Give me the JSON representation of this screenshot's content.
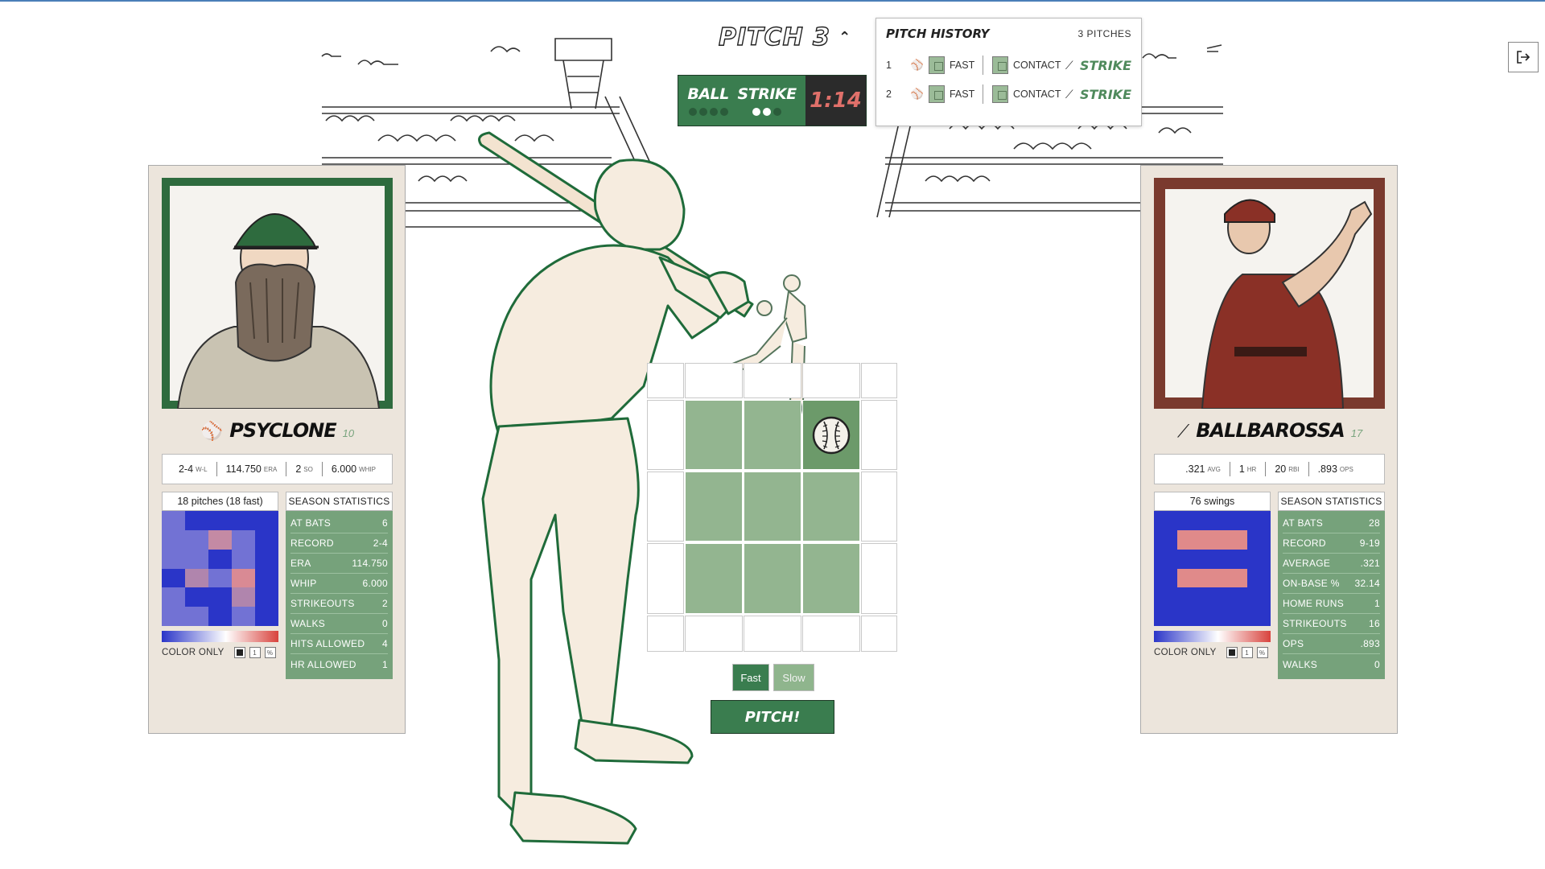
{
  "header": {
    "pitch_title": "PITCH 3"
  },
  "count": {
    "ball_label": "BALL",
    "strike_label": "STRIKE",
    "balls": 0,
    "strikes": 2,
    "timer": "1:14"
  },
  "history": {
    "title": "PITCH HISTORY",
    "count_label": "3 PITCHES",
    "rows": [
      {
        "num": "1",
        "pitch_type": "FAST",
        "result_type": "CONTACT",
        "outcome": "STRIKE"
      },
      {
        "num": "2",
        "pitch_type": "FAST",
        "result_type": "CONTACT",
        "outcome": "STRIKE"
      }
    ]
  },
  "pitcher": {
    "name": "PSYCLONE",
    "number": "10",
    "line": [
      {
        "value": "2-4",
        "unit": "W-L"
      },
      {
        "value": "114.750",
        "unit": "ERA"
      },
      {
        "value": "2",
        "unit": "SO"
      },
      {
        "value": "6.000",
        "unit": "WHIP"
      }
    ],
    "heatmap_label": "18 pitches (18 fast)",
    "color_only_label": "COLOR ONLY",
    "season_title": "SEASON STATISTICS",
    "season": [
      {
        "label": "AT BATS",
        "value": "6"
      },
      {
        "label": "RECORD",
        "value": "2-4"
      },
      {
        "label": "ERA",
        "value": "114.750"
      },
      {
        "label": "WHIP",
        "value": "6.000"
      },
      {
        "label": "STRIKEOUTS",
        "value": "2"
      },
      {
        "label": "WALKS",
        "value": "0"
      },
      {
        "label": "HITS ALLOWED",
        "value": "4"
      },
      {
        "label": "HR ALLOWED",
        "value": "1"
      }
    ]
  },
  "batter": {
    "name": "BALLBAROSSA",
    "number": "17",
    "line": [
      {
        "value": ".321",
        "unit": "AVG"
      },
      {
        "value": "1",
        "unit": "HR"
      },
      {
        "value": "20",
        "unit": "RBI"
      },
      {
        "value": ".893",
        "unit": "OPS"
      }
    ],
    "heatmap_label": "76 swings",
    "color_only_label": "COLOR ONLY",
    "season_title": "SEASON STATISTICS",
    "season": [
      {
        "label": "AT BATS",
        "value": "28"
      },
      {
        "label": "RECORD",
        "value": "9-19"
      },
      {
        "label": "AVERAGE",
        "value": ".321"
      },
      {
        "label": "ON-BASE %",
        "value": "32.14"
      },
      {
        "label": "HOME RUNS",
        "value": "1"
      },
      {
        "label": "STRIKEOUTS",
        "value": "16"
      },
      {
        "label": "OPS",
        "value": ".893"
      },
      {
        "label": "WALKS",
        "value": "0"
      }
    ]
  },
  "controls": {
    "fast_label": "Fast",
    "slow_label": "Slow",
    "pitch_label": "PITCH!"
  },
  "colors": {
    "accent_green": "#3a7d4f",
    "zone_green": "#93b590",
    "timer_red": "#e0706a",
    "heat_cold": "#2a35c8",
    "heat_hot": "#d8433d"
  }
}
